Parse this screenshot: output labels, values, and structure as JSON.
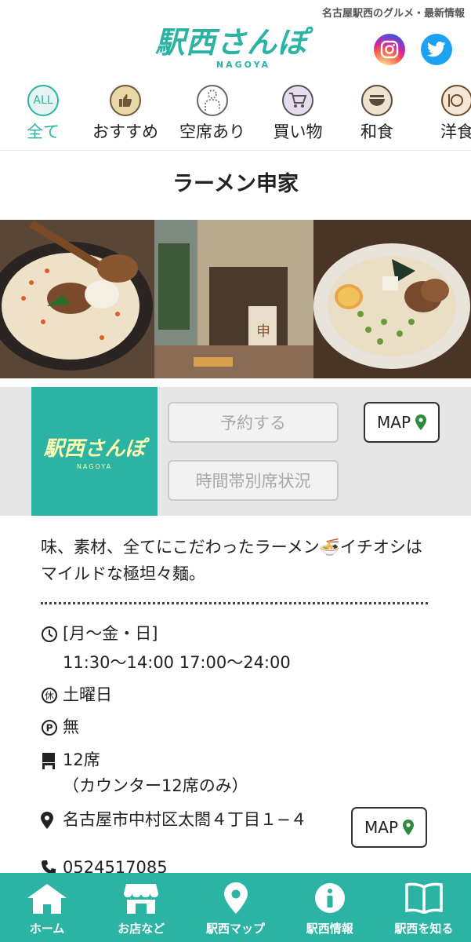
{
  "header": {
    "tagline": "名古屋駅西のグルメ・最新情報",
    "logo_main": "駅西さんぽ",
    "logo_sub": "NAGOYA"
  },
  "categories": [
    {
      "label": "全て",
      "icon_text": "ALL",
      "icon": "all-icon"
    },
    {
      "label": "おすすめ",
      "icon": "thumbs-up-icon"
    },
    {
      "label": "空席あり",
      "icon": "person-icon"
    },
    {
      "label": "買い物",
      "icon": "cart-icon"
    },
    {
      "label": "和食",
      "icon": "bowl-icon"
    },
    {
      "label": "洋食",
      "icon": "plate-icon"
    }
  ],
  "shop": {
    "name": "ラーメン申家",
    "thumb_logo_main": "駅西さんぽ",
    "thumb_logo_sub": "NAGOYA",
    "reserve_label": "予約する",
    "seat_status_label": "時間帯別席状況",
    "map_label": "MAP",
    "description": "味、素材、全てにこだわったラーメン🍜イチオシはマイルドな極坦々麺。",
    "hours_days": "[月〜金・日]",
    "hours_times": "11:30〜14:00 17:00〜24:00",
    "closed": "土曜日",
    "parking": "無",
    "seats": "12席",
    "seats_note": "（カウンター12席のみ）",
    "address": "名古屋市中村区太閤４丁目１−４",
    "phone": "0524517085"
  },
  "bottom_nav": [
    {
      "label": "ホーム",
      "icon": "home-icon"
    },
    {
      "label": "お店など",
      "icon": "shop-icon"
    },
    {
      "label": "駅西マップ",
      "icon": "map-pin-icon"
    },
    {
      "label": "駅西情報",
      "icon": "info-icon"
    },
    {
      "label": "駅西を知る",
      "icon": "book-icon"
    }
  ],
  "colors": {
    "brand": "#2bb3a3",
    "map_pin": "#2e8b3c"
  }
}
